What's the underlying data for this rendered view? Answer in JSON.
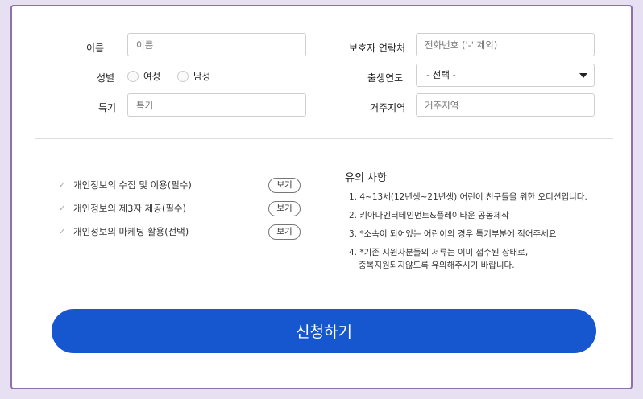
{
  "form": {
    "name_label": "이름",
    "name_placeholder": "이름",
    "guardian_label": "보호자 연락처",
    "guardian_placeholder": "전화번호 ('-' 제외)",
    "gender_label": "성별",
    "gender_options": [
      "여성",
      "남성"
    ],
    "birth_label": "출생연도",
    "birth_selected": "- 선택 -",
    "talent_label": "특기",
    "talent_placeholder": "특기",
    "region_label": "거주지역",
    "region_placeholder": "거주지역"
  },
  "agreements": [
    {
      "label": "개인정보의 수집 및 이용(필수)",
      "button": "보기"
    },
    {
      "label": "개인정보의 제3자 제공(필수)",
      "button": "보기"
    },
    {
      "label": "개인정보의 마케팅 활용(선택)",
      "button": "보기"
    }
  ],
  "notice": {
    "title": "유의 사항",
    "items": [
      "1. 4~13세(12년생~21년생) 어린이 친구들을 위한 오디션입니다.",
      "2. 키아나엔터테인먼트&플레이타운 공동제작",
      "3. *소속이 되어있는 어린이의 경우 특기부분에 적어주세요",
      "4. *기존 지원자분들의 서류는 이미 접수된 상태로,",
      "중복지원되지않도록 유의해주시기 바랍니다."
    ]
  },
  "submit_label": "신청하기",
  "colors": {
    "accent": "#1657d0",
    "frame": "#8f6fb0"
  }
}
